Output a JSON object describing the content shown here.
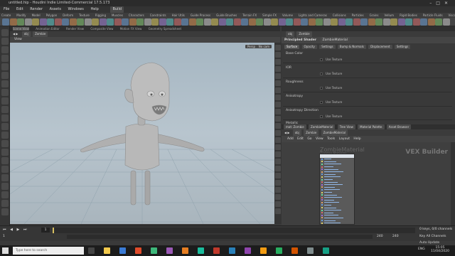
{
  "window": {
    "title": "untitled.hip - Houdini Indie Limited-Commercial 17.5.173"
  },
  "menu": [
    "File",
    "Edit",
    "Render",
    "Assets",
    "Windows",
    "Help"
  ],
  "desktop_label": "Build",
  "shelf_tabs": [
    "Create",
    "Modify",
    "Model",
    "Polygon",
    "Deform",
    "Texture",
    "Rigging",
    "Muscles",
    "Characters",
    "Constraints",
    "Hair Utils",
    "Guide Process",
    "Guide Brushes",
    "Terrain FX",
    "Simple FX",
    "Volume",
    "Lights and Cameras",
    "Collisions",
    "Particles",
    "Grains",
    "Vellum",
    "Rigid Bodies",
    "Particle Fluids",
    "Viscous Fluids",
    "Oceans",
    "Fluid Containers",
    "Populate Containers",
    "Container Tools",
    "Pyro FX",
    "FEM",
    "Wires",
    "Crowds",
    "Drive Simulation"
  ],
  "viewer": {
    "tabs": [
      "Scene View",
      "Animation Editor",
      "Render View",
      "Composite View",
      "Motion FX View",
      "Geometry Spreadsheet"
    ],
    "path": [
      "obj",
      "Zombie"
    ],
    "label": "View",
    "cam_persp": "Persp",
    "cam_no": "No cam"
  },
  "params": {
    "node_type": "Principled Shader",
    "node_name": "ZombieMaterial",
    "tabs": [
      "Surface",
      "Opacity",
      "Settings",
      "Bump & Normals",
      "Displacement",
      "Settings"
    ],
    "rows": [
      {
        "label": "Base Color",
        "tex": "Use Texture"
      },
      {
        "label": "IOR",
        "tex": "Use Texture"
      },
      {
        "label": "Roughness",
        "tex": "Use Texture"
      },
      {
        "label": "Anisotropy",
        "tex": "Use Texture"
      },
      {
        "label": "Anisotropy Direction",
        "tex": "Use Texture"
      },
      {
        "label": "Metallic",
        "tex": ""
      }
    ]
  },
  "network": {
    "tabs": [
      "mat: Zombie",
      "ZombieMaterial",
      "Tree View",
      "Material Palette",
      "Asset Browser"
    ],
    "path": [
      "obj",
      "Zombie",
      "ZombieMaterial"
    ],
    "menu": [
      "Add",
      "Edit",
      "Go",
      "View",
      "Tools",
      "Layout",
      "Help"
    ],
    "watermark": "VEX Builder",
    "node_title": "ZombieMaterial",
    "node_subtitle": "Zombie Material"
  },
  "timeline": {
    "frame": "1",
    "start": "1",
    "end": "240",
    "end2": "240",
    "keys_label": "0 keys, 0/0 channels",
    "all_label": "Key All Channels",
    "auto_update": "Auto Update"
  },
  "taskbar": {
    "search": "Type here to search",
    "time": "15:05",
    "date": "11/04/2020",
    "lang": "ENG"
  }
}
